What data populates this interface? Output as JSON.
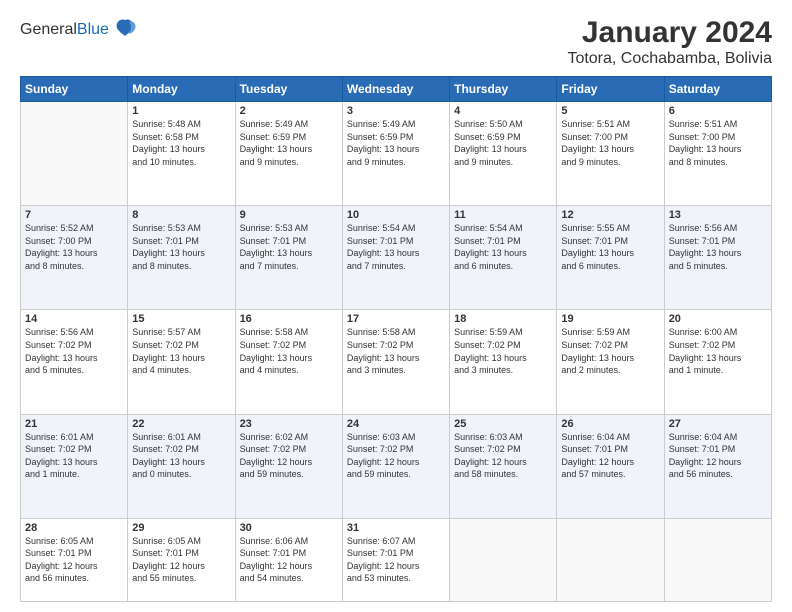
{
  "header": {
    "logo_line1": "General",
    "logo_line2": "Blue",
    "title": "January 2024",
    "subtitle": "Totora, Cochabamba, Bolivia"
  },
  "calendar": {
    "columns": [
      "Sunday",
      "Monday",
      "Tuesday",
      "Wednesday",
      "Thursday",
      "Friday",
      "Saturday"
    ],
    "weeks": [
      [
        {
          "day": "",
          "info": ""
        },
        {
          "day": "1",
          "info": "Sunrise: 5:48 AM\nSunset: 6:58 PM\nDaylight: 13 hours\nand 10 minutes."
        },
        {
          "day": "2",
          "info": "Sunrise: 5:49 AM\nSunset: 6:59 PM\nDaylight: 13 hours\nand 9 minutes."
        },
        {
          "day": "3",
          "info": "Sunrise: 5:49 AM\nSunset: 6:59 PM\nDaylight: 13 hours\nand 9 minutes."
        },
        {
          "day": "4",
          "info": "Sunrise: 5:50 AM\nSunset: 6:59 PM\nDaylight: 13 hours\nand 9 minutes."
        },
        {
          "day": "5",
          "info": "Sunrise: 5:51 AM\nSunset: 7:00 PM\nDaylight: 13 hours\nand 9 minutes."
        },
        {
          "day": "6",
          "info": "Sunrise: 5:51 AM\nSunset: 7:00 PM\nDaylight: 13 hours\nand 8 minutes."
        }
      ],
      [
        {
          "day": "7",
          "info": "Sunrise: 5:52 AM\nSunset: 7:00 PM\nDaylight: 13 hours\nand 8 minutes."
        },
        {
          "day": "8",
          "info": "Sunrise: 5:53 AM\nSunset: 7:01 PM\nDaylight: 13 hours\nand 8 minutes."
        },
        {
          "day": "9",
          "info": "Sunrise: 5:53 AM\nSunset: 7:01 PM\nDaylight: 13 hours\nand 7 minutes."
        },
        {
          "day": "10",
          "info": "Sunrise: 5:54 AM\nSunset: 7:01 PM\nDaylight: 13 hours\nand 7 minutes."
        },
        {
          "day": "11",
          "info": "Sunrise: 5:54 AM\nSunset: 7:01 PM\nDaylight: 13 hours\nand 6 minutes."
        },
        {
          "day": "12",
          "info": "Sunrise: 5:55 AM\nSunset: 7:01 PM\nDaylight: 13 hours\nand 6 minutes."
        },
        {
          "day": "13",
          "info": "Sunrise: 5:56 AM\nSunset: 7:01 PM\nDaylight: 13 hours\nand 5 minutes."
        }
      ],
      [
        {
          "day": "14",
          "info": "Sunrise: 5:56 AM\nSunset: 7:02 PM\nDaylight: 13 hours\nand 5 minutes."
        },
        {
          "day": "15",
          "info": "Sunrise: 5:57 AM\nSunset: 7:02 PM\nDaylight: 13 hours\nand 4 minutes."
        },
        {
          "day": "16",
          "info": "Sunrise: 5:58 AM\nSunset: 7:02 PM\nDaylight: 13 hours\nand 4 minutes."
        },
        {
          "day": "17",
          "info": "Sunrise: 5:58 AM\nSunset: 7:02 PM\nDaylight: 13 hours\nand 3 minutes."
        },
        {
          "day": "18",
          "info": "Sunrise: 5:59 AM\nSunset: 7:02 PM\nDaylight: 13 hours\nand 3 minutes."
        },
        {
          "day": "19",
          "info": "Sunrise: 5:59 AM\nSunset: 7:02 PM\nDaylight: 13 hours\nand 2 minutes."
        },
        {
          "day": "20",
          "info": "Sunrise: 6:00 AM\nSunset: 7:02 PM\nDaylight: 13 hours\nand 1 minute."
        }
      ],
      [
        {
          "day": "21",
          "info": "Sunrise: 6:01 AM\nSunset: 7:02 PM\nDaylight: 13 hours\nand 1 minute."
        },
        {
          "day": "22",
          "info": "Sunrise: 6:01 AM\nSunset: 7:02 PM\nDaylight: 13 hours\nand 0 minutes."
        },
        {
          "day": "23",
          "info": "Sunrise: 6:02 AM\nSunset: 7:02 PM\nDaylight: 12 hours\nand 59 minutes."
        },
        {
          "day": "24",
          "info": "Sunrise: 6:03 AM\nSunset: 7:02 PM\nDaylight: 12 hours\nand 59 minutes."
        },
        {
          "day": "25",
          "info": "Sunrise: 6:03 AM\nSunset: 7:02 PM\nDaylight: 12 hours\nand 58 minutes."
        },
        {
          "day": "26",
          "info": "Sunrise: 6:04 AM\nSunset: 7:01 PM\nDaylight: 12 hours\nand 57 minutes."
        },
        {
          "day": "27",
          "info": "Sunrise: 6:04 AM\nSunset: 7:01 PM\nDaylight: 12 hours\nand 56 minutes."
        }
      ],
      [
        {
          "day": "28",
          "info": "Sunrise: 6:05 AM\nSunset: 7:01 PM\nDaylight: 12 hours\nand 56 minutes."
        },
        {
          "day": "29",
          "info": "Sunrise: 6:05 AM\nSunset: 7:01 PM\nDaylight: 12 hours\nand 55 minutes."
        },
        {
          "day": "30",
          "info": "Sunrise: 6:06 AM\nSunset: 7:01 PM\nDaylight: 12 hours\nand 54 minutes."
        },
        {
          "day": "31",
          "info": "Sunrise: 6:07 AM\nSunset: 7:01 PM\nDaylight: 12 hours\nand 53 minutes."
        },
        {
          "day": "",
          "info": ""
        },
        {
          "day": "",
          "info": ""
        },
        {
          "day": "",
          "info": ""
        }
      ]
    ]
  }
}
